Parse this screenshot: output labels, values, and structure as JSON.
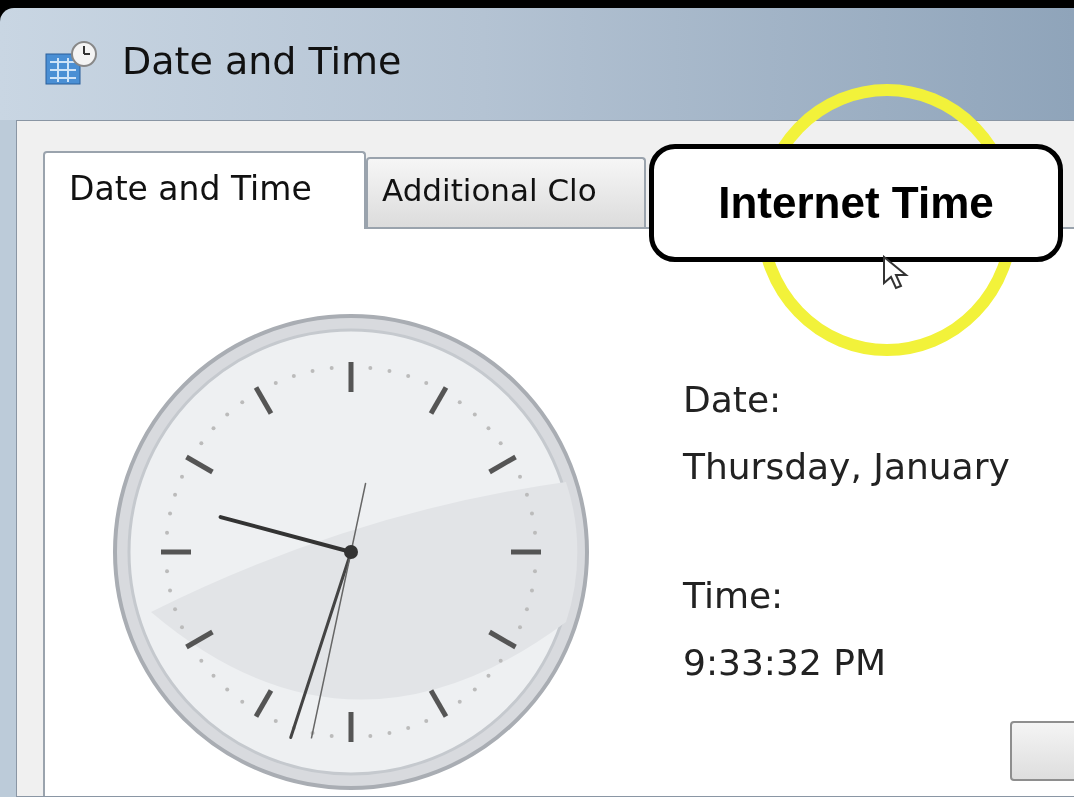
{
  "window": {
    "title": "Date and Time"
  },
  "tabs": [
    {
      "label": "Date and Time",
      "selected": true
    },
    {
      "label": "Additional Clo",
      "selected": false
    }
  ],
  "callout": {
    "text": "Internet Time"
  },
  "date": {
    "label": "Date:",
    "value": "Thursday, January"
  },
  "time": {
    "label": "Time:",
    "value": "9:33:32 PM"
  }
}
